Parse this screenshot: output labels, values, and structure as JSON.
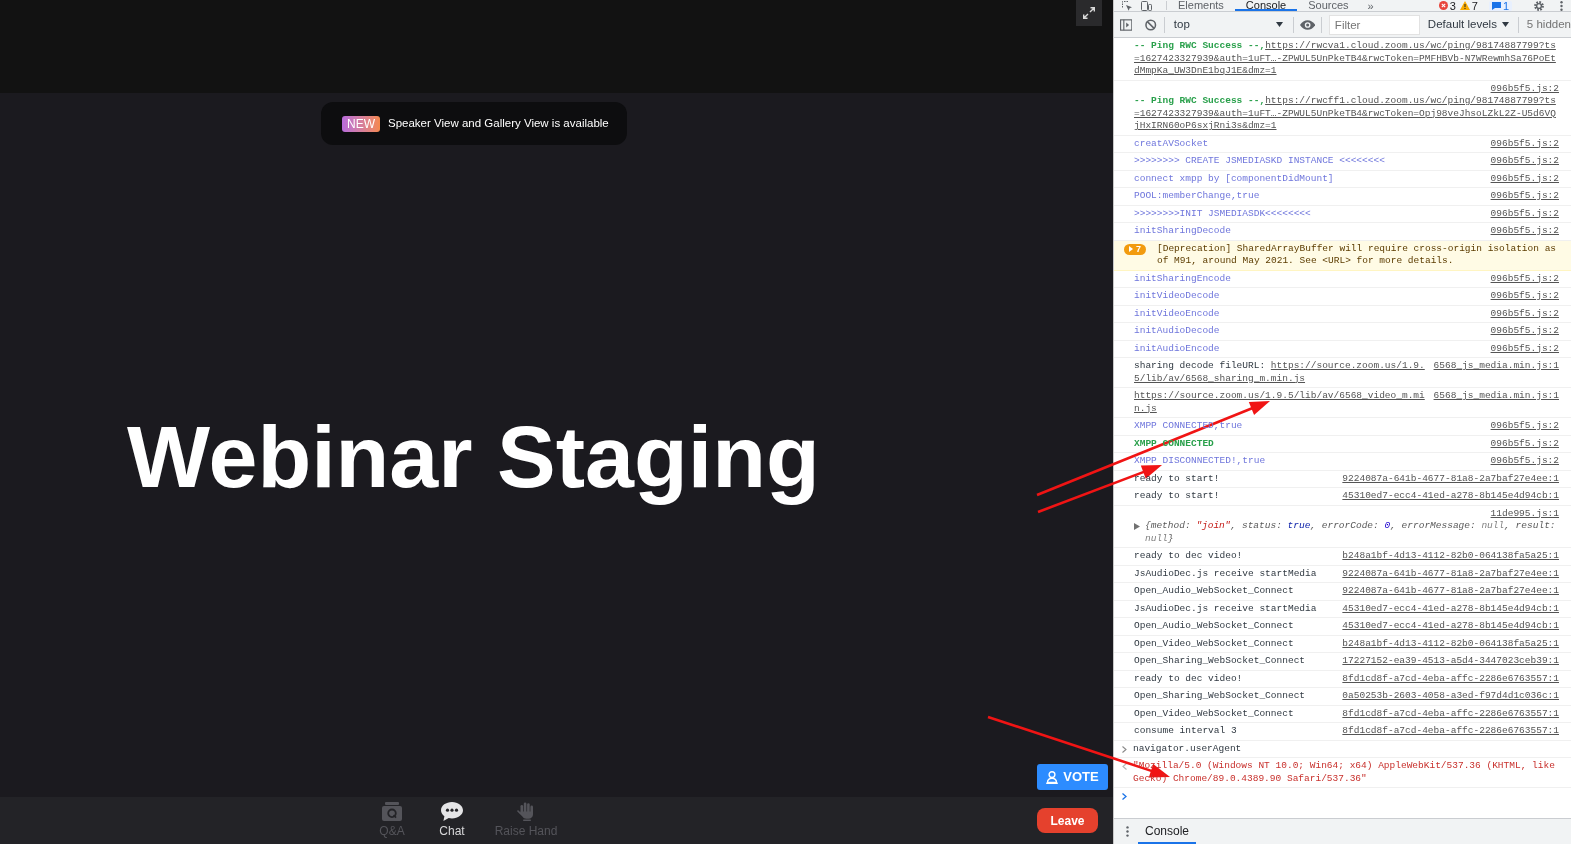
{
  "meeting": {
    "banner": {
      "badge": "NEW",
      "text": "Speaker View and Gallery View is available"
    },
    "shared_screen": {
      "title": "Webinar Staging"
    },
    "vote_button": {
      "label": "VOTE"
    },
    "toolbar": [
      {
        "kind": "qa",
        "label": "Q&A",
        "disabled": true
      },
      {
        "kind": "chat",
        "label": "Chat",
        "disabled": false
      },
      {
        "kind": "raise_hand",
        "label": "Raise Hand",
        "disabled": true
      }
    ],
    "leave_button": {
      "label": "Leave"
    }
  },
  "devtools": {
    "tabs": [
      {
        "label": "Elements",
        "selected": false
      },
      {
        "label": "Console",
        "selected": true
      },
      {
        "label": "Sources",
        "selected": false
      }
    ],
    "more_tabs": "»",
    "counters": [
      {
        "kind": "error",
        "count": "3"
      },
      {
        "kind": "warning",
        "count": "7"
      },
      {
        "kind": "issue",
        "count": "1"
      }
    ],
    "toolbar": {
      "context": "top",
      "filter": {
        "placeholder": "Filter"
      },
      "levels": "Default levels",
      "hidden": "5 hidden"
    },
    "messages": [
      {
        "kind": "success",
        "text": "-- Ping RWC Success --,",
        "link": "https://rwcva1.cloud.zoom.us/wc/ping/98174887799?ts=1627423327939&auth=1uFT…-ZPWUL5UnPkeTB4&rwcToken=PMFHBVb-N7WRewmhSa76PoEtdMmpKa_UW3DnE1bqJ1E&dmz=1"
      },
      {
        "kind": "success",
        "text": "-- Ping RWC Success --,",
        "link": "https://rwcff1.cloud.zoom.us/wc/ping/98174887799?ts=1627423327939&auth=1uFT…-ZPWUL5UnPkeTB4&rwcToken=Opj98veJhsoLZkL2Z-U5d6VQjHxIRN60oP6sxjRni3s&dmz=1",
        "source": "096b5f5.js:2",
        "source_on_own_line": true
      },
      {
        "kind": "info",
        "text": "creatAVSocket",
        "source": "096b5f5.js:2"
      },
      {
        "kind": "info",
        "text": ">>>>>>>> CREATE JSMEDIASKD INSTANCE <<<<<<<<",
        "source": "096b5f5.js:2"
      },
      {
        "kind": "info",
        "text": "connect xmpp by [componentDidMount]",
        "source": "096b5f5.js:2"
      },
      {
        "kind": "info",
        "text": "POOL:memberChange,true",
        "source": "096b5f5.js:2"
      },
      {
        "kind": "info",
        "text": ">>>>>>>>INIT JSMEDIASDK<<<<<<<<",
        "source": "096b5f5.js:2"
      },
      {
        "kind": "info",
        "text": "initSharingDecode",
        "source": "096b5f5.js:2"
      },
      {
        "kind": "warning",
        "count": "7",
        "expanded": false,
        "text": "[Deprecation] SharedArrayBuffer will require cross-origin isolation as of M91, around May 2021. See <URL> for more details."
      },
      {
        "kind": "info",
        "text": "initSharingEncode",
        "source": "096b5f5.js:2"
      },
      {
        "kind": "info",
        "text": "initVideoDecode",
        "source": "096b5f5.js:2"
      },
      {
        "kind": "info",
        "text": "initVideoEncode",
        "source": "096b5f5.js:2"
      },
      {
        "kind": "info",
        "text": "initAudioDecode",
        "source": "096b5f5.js:2"
      },
      {
        "kind": "info",
        "text": "initAudioEncode",
        "source": "096b5f5.js:2"
      },
      {
        "kind": "log",
        "text": "sharing decode fileURL: ",
        "link": "https://source.zoom.us/1.9.5/lib/av/6568_sharing_m.min.js",
        "source": "6568_js_media.min.js:1"
      },
      {
        "kind": "log",
        "link": "https://source.zoom.us/1.9.5/lib/av/6568_video_m.min.js",
        "source": "6568_js_media.min.js:1"
      },
      {
        "kind": "info",
        "text": "XMPP CONNECTED,true",
        "source": "096b5f5.js:2"
      },
      {
        "kind": "success",
        "text": "XMPP CONNECTED",
        "source": "096b5f5.js:2"
      },
      {
        "kind": "info",
        "text": "XMPP DISCONNECTED!,true",
        "source": "096b5f5.js:2"
      },
      {
        "kind": "log",
        "text": "ready to start!",
        "source": "9224087a-641b-4677-81a8-2a7baf27e4ee:1"
      },
      {
        "kind": "log",
        "text": "ready to start!",
        "source": "45310ed7-ecc4-41ed-a278-8b145e4d94cb:1"
      },
      {
        "kind": "object",
        "expanded": false,
        "source": "11de995.js:1",
        "segments": [
          {
            "text": "{method: ",
            "kind": "plain"
          },
          {
            "text": "\"join\"",
            "kind": "string"
          },
          {
            "text": ", status: ",
            "kind": "plain"
          },
          {
            "text": "true",
            "kind": "boolean"
          },
          {
            "text": ", errorCode: ",
            "kind": "plain"
          },
          {
            "text": "0",
            "kind": "number"
          },
          {
            "text": ", errorMessage: ",
            "kind": "plain"
          },
          {
            "text": "null",
            "kind": "null"
          },
          {
            "text": ", result: ",
            "kind": "plain"
          },
          {
            "text": "null",
            "kind": "null"
          },
          {
            "text": "}",
            "kind": "plain"
          }
        ]
      },
      {
        "kind": "log",
        "text": "ready to dec video!",
        "source": "b248a1bf-4d13-4112-82b0-064138fa5a25:1"
      },
      {
        "kind": "log",
        "text": "JsAudioDec.js receive startMedia",
        "source": "9224087a-641b-4677-81a8-2a7baf27e4ee:1"
      },
      {
        "kind": "log",
        "text": "Open_Audio_WebSocket_Connect",
        "source": "9224087a-641b-4677-81a8-2a7baf27e4ee:1"
      },
      {
        "kind": "log",
        "text": "JsAudioDec.js receive startMedia",
        "source": "45310ed7-ecc4-41ed-a278-8b145e4d94cb:1"
      },
      {
        "kind": "log",
        "text": "Open_Audio_WebSocket_Connect",
        "source": "45310ed7-ecc4-41ed-a278-8b145e4d94cb:1"
      },
      {
        "kind": "log",
        "text": "Open_Video_WebSocket_Connect",
        "source": "b248a1bf-4d13-4112-82b0-064138fa5a25:1"
      },
      {
        "kind": "log",
        "text": "Open_Sharing_WebSocket_Connect",
        "source": "17227152-ea39-4513-a5d4-3447023ceb39:1"
      },
      {
        "kind": "log",
        "text": "ready to dec video!",
        "source": "8fd1cd8f-a7cd-4eba-affc-2286e6763557:1"
      },
      {
        "kind": "log",
        "text": "Open_Sharing_WebSocket_Connect",
        "source": "0a50253b-2603-4058-a3ed-f97d4d1c036c:1"
      },
      {
        "kind": "log",
        "text": "Open_Video_WebSocket_Connect",
        "source": "8fd1cd8f-a7cd-4eba-affc-2286e6763557:1"
      },
      {
        "kind": "log",
        "text": "consume interval 3",
        "source": "8fd1cd8f-a7cd-4eba-affc-2286e6763557:1"
      },
      {
        "kind": "input",
        "text": "navigator.userAgent"
      },
      {
        "kind": "result",
        "text": "\"Mozilla/5.0 (Windows NT 10.0; Win64; x64) AppleWebKit/537.36 (KHTML, like Gecko) Chrome/89.0.4389.90 Safari/537.36\""
      },
      {
        "kind": "prompt"
      }
    ],
    "drawer_tabs": [
      {
        "label": "Console",
        "selected": true
      }
    ]
  }
}
